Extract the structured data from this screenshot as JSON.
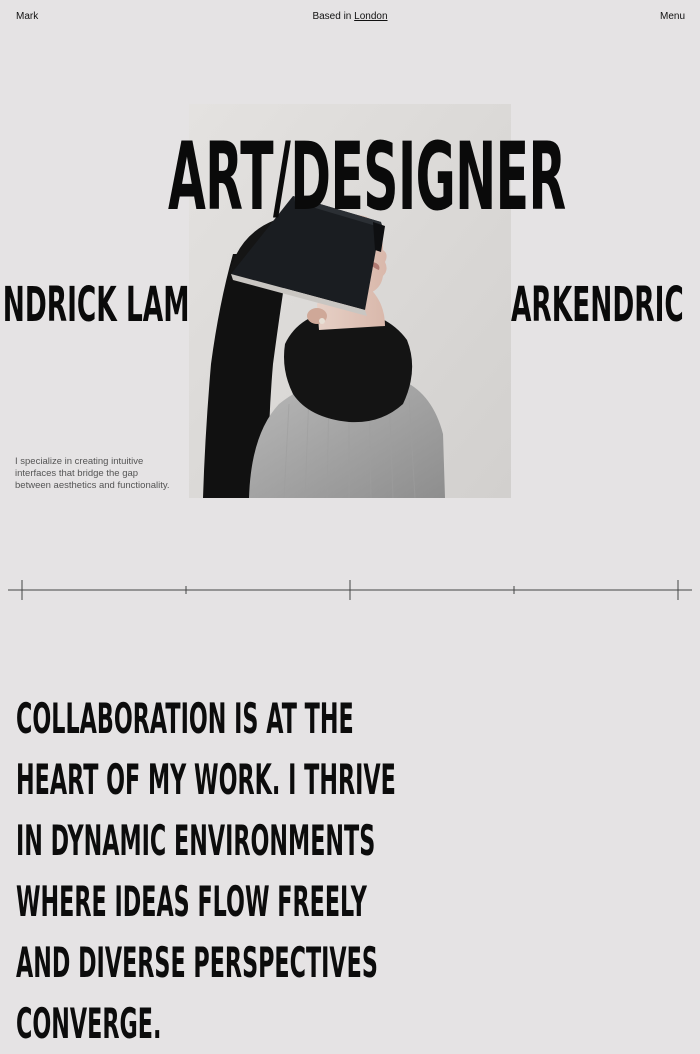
{
  "header": {
    "brand": "Mark",
    "location_prefix": "Based in ",
    "location_link": "London",
    "menu_label": "Menu"
  },
  "hero": {
    "headline": "ART/DESIGNER",
    "marquee_left": "NDRICK LAM",
    "marquee_right": "ARKENDRIC",
    "intro": "I specialize in creating intuitive interfaces that bridge the gap between aesthetics and functionality."
  },
  "statement": {
    "lines": [
      "COLLABORATION IS AT THE",
      "HEART OF MY WORK. I THRIVE",
      "IN DYNAMIC ENVIRONMENTS",
      "WHERE IDEAS FLOW FREELY",
      "AND DIVERSE PERSPECTIVES",
      "CONVERGE."
    ]
  }
}
